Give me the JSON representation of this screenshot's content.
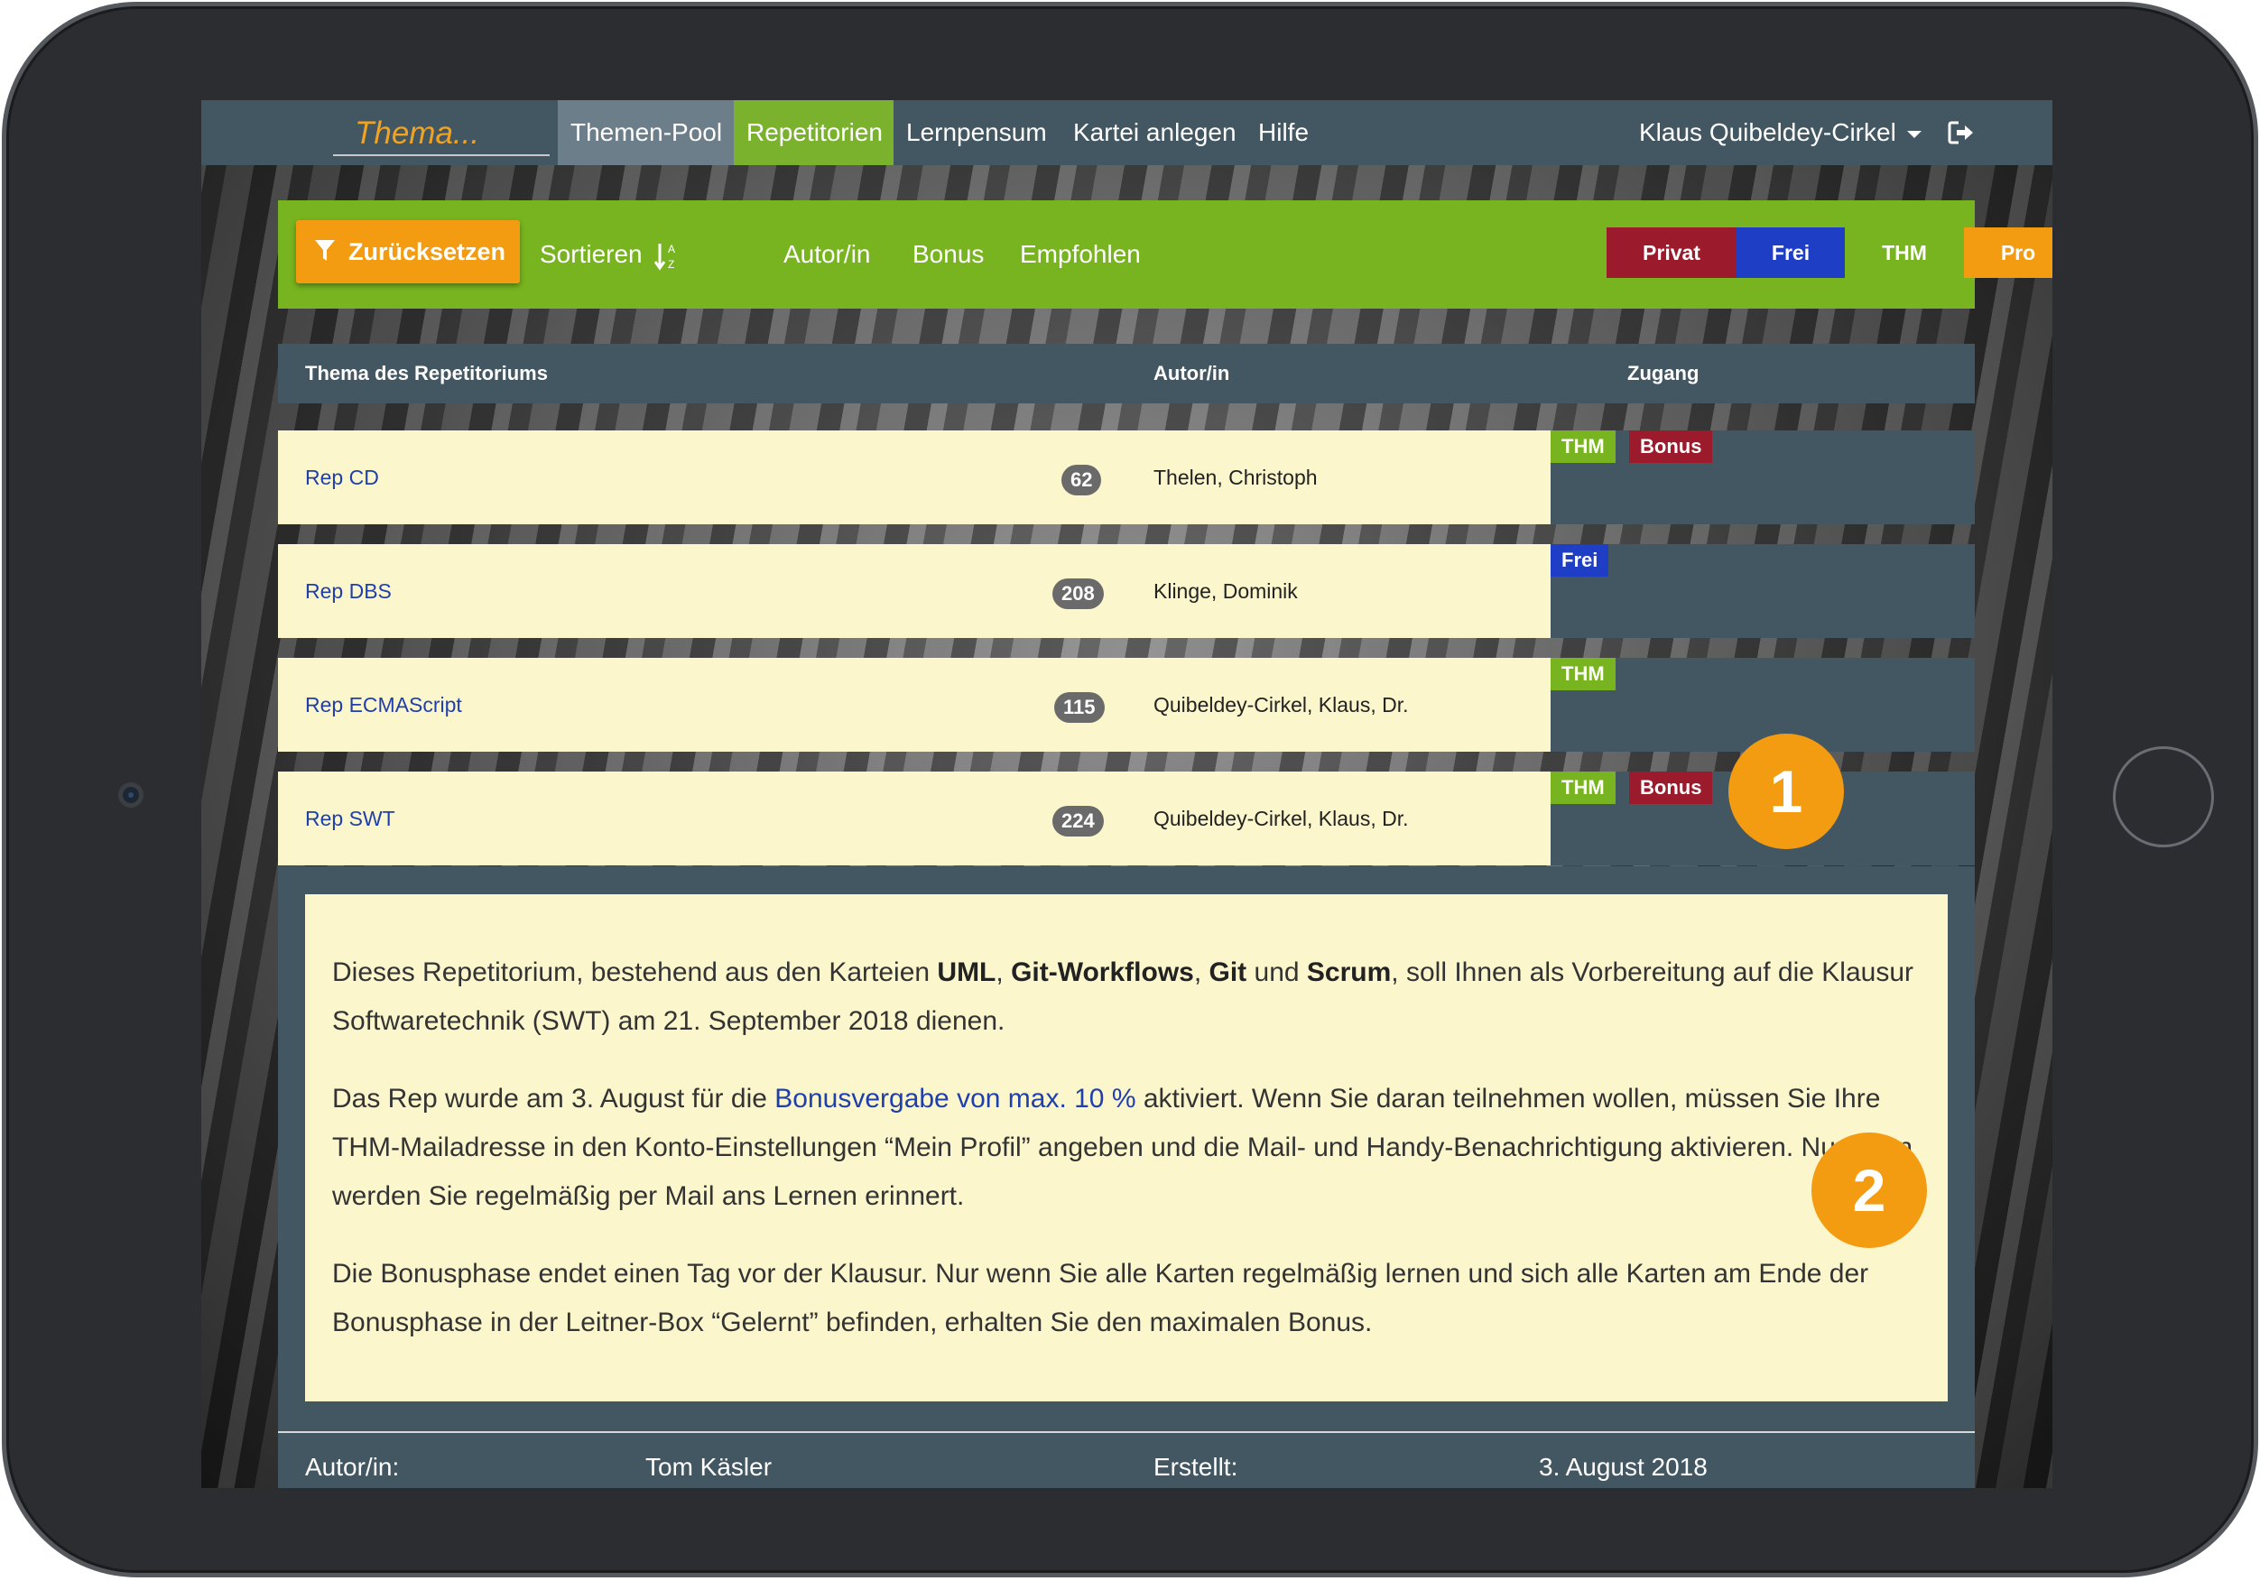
{
  "nav": {
    "search_text": "Thema...",
    "links": [
      "Themen-Pool",
      "Repetitorien",
      "Lernpensum",
      "Kartei anlegen",
      "Hilfe"
    ],
    "user": "Klaus Quibeldey-Cirkel"
  },
  "filters": {
    "reset": "Zurücksetzen",
    "sort": "Sortieren",
    "author": "Autor/in",
    "bonus": "Bonus",
    "recommended": "Empfohlen",
    "access": [
      "Privat",
      "Frei",
      "THM",
      "Pro"
    ]
  },
  "table": {
    "headers": [
      "Thema des Repetitoriums",
      "Autor/in",
      "Zugang"
    ],
    "rows": [
      {
        "title": "Rep CD",
        "count": "62",
        "author": "Thelen, Christoph",
        "tags": [
          "THM",
          "Bonus"
        ]
      },
      {
        "title": "Rep DBS",
        "count": "208",
        "author": "Klinge, Dominik",
        "tags": [
          "Frei"
        ]
      },
      {
        "title": "Rep ECMAScript",
        "count": "115",
        "author": "Quibeldey-Cirkel, Klaus, Dr.",
        "tags": [
          "THM"
        ]
      },
      {
        "title": "Rep SWT",
        "count": "224",
        "author": "Quibeldey-Cirkel, Klaus, Dr.",
        "tags": [
          "THM",
          "Bonus"
        ]
      }
    ]
  },
  "detail": {
    "p1_a": "Dieses Repetitorium, bestehend aus den Karteien ",
    "p1_uml": "UML",
    "p1_sep1": ", ",
    "p1_gw": "Git-Workflows",
    "p1_sep2": ", ",
    "p1_git": "Git",
    "p1_und": " und ",
    "p1_scrum": "Scrum",
    "p1_b": ", soll Ihnen als Vorbereitung auf die Klausur Softwaretechnik (SWT) am 21. September 2018 dienen.",
    "p2_a": "Das Rep wurde am 3. August für die ",
    "p2_link": "Bonusvergabe von max. 10 %",
    "p2_b": " aktiviert. Wenn Sie daran teilnehmen wollen, müssen Sie Ihre THM-Mailadresse in den Konto-Einstellungen “Mein Profil” angeben und die Mail- und Handy-Benachrichtigung aktivieren. Nur dann werden Sie regelmäßig per Mail ans Lernen erinnert.",
    "p3": "Die Bonusphase endet einen Tag vor der Klausur. Nur wenn Sie alle Karten regelmäßig lernen und sich alle Karten am Ende der Bonusphase in der Leitner-Box “Gelernt” befinden, erhalten Sie den maximalen Bonus.",
    "meta_author_label": "Autor/in:",
    "meta_author": "Tom Käsler",
    "meta_created_label": "Erstellt:",
    "meta_created": "3. August 2018"
  },
  "callouts": [
    "1",
    "2"
  ]
}
